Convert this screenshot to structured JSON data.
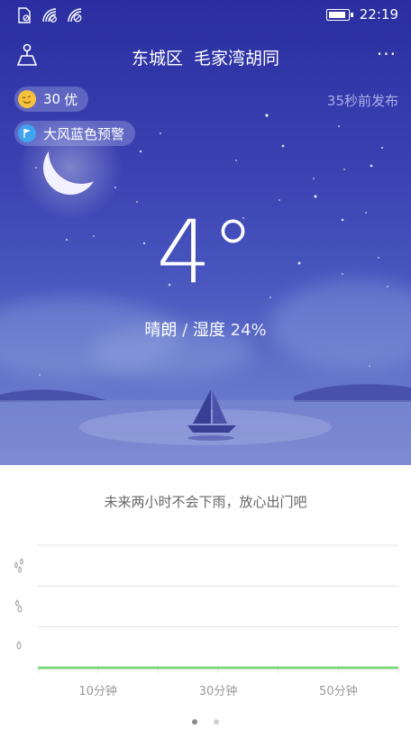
{
  "status_bar": {
    "time": "22:19",
    "battery_level": 0.95,
    "icons": [
      "sim-card-icon",
      "wifi-icon",
      "no-signal-icon"
    ]
  },
  "header": {
    "district": "东城区",
    "street": "毛家湾胡同",
    "more_label": "···"
  },
  "air_quality": {
    "value": "30",
    "level": "优",
    "icon": "smile-face-icon"
  },
  "alert": {
    "label": "大风蓝色预警",
    "icon": "wind-flag-icon"
  },
  "published": "35秒前发布",
  "current": {
    "temperature": "4°",
    "condition": "晴朗",
    "separator": "/",
    "humidity_label": "湿度",
    "humidity": "24%"
  },
  "rain_forecast": {
    "message": "未来两小时不会下雨，放心出门吧",
    "x_tick_labels": [
      "10分钟",
      "30分钟",
      "50分钟"
    ],
    "intensity_icons": [
      "heavy-rain-drops-icon",
      "moderate-rain-drops-icon",
      "light-rain-drop-icon"
    ]
  },
  "chart_data": {
    "type": "area",
    "title": "",
    "xlabel": "",
    "ylabel": "",
    "x_tick_labels": [
      "10分钟",
      "30分钟",
      "50分钟"
    ],
    "x": [
      0,
      120
    ],
    "values": [
      0,
      0
    ],
    "ylim": [
      0,
      3
    ],
    "grid": true,
    "series_color": "#7ed87e"
  },
  "pagination": {
    "pages": 2,
    "current": 1
  },
  "colors": {
    "accent_line": "#7ed87e",
    "hero_top": "#2a2ea0",
    "hero_bottom": "#7683cf"
  }
}
